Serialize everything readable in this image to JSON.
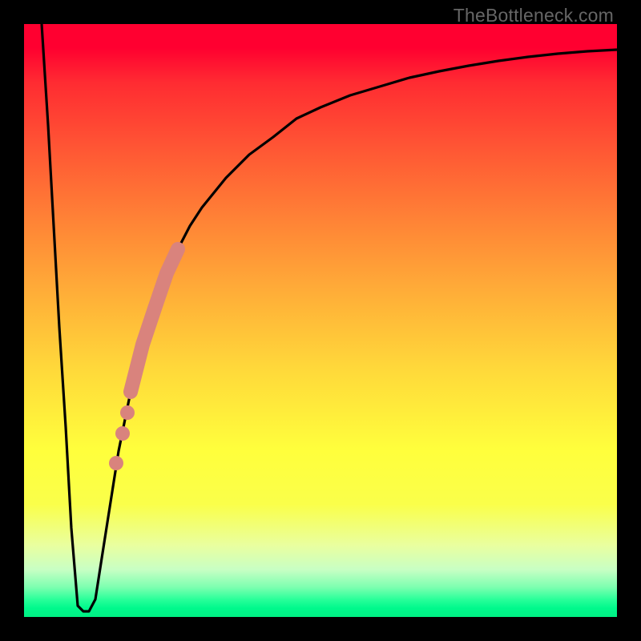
{
  "watermark": "TheBottleneck.com",
  "chart_data": {
    "type": "line",
    "title": "",
    "xlabel": "",
    "ylabel": "",
    "xlim": [
      0,
      100
    ],
    "ylim": [
      0,
      100
    ],
    "grid": false,
    "legend": false,
    "series": [
      {
        "name": "bottleneck-curve",
        "color": "#000000",
        "x": [
          3,
          4,
          5,
          6,
          7,
          8,
          9,
          10,
          11,
          12,
          13,
          14,
          16,
          18,
          20,
          22,
          24,
          26,
          28,
          30,
          34,
          38,
          42,
          46,
          50,
          55,
          60,
          65,
          70,
          75,
          80,
          85,
          90,
          95,
          100
        ],
        "y": [
          100,
          83,
          66,
          49,
          32,
          15,
          2,
          1,
          1,
          3,
          9,
          16,
          28,
          38,
          46,
          52,
          58,
          62,
          66,
          69,
          74,
          78,
          81,
          84,
          86,
          88,
          89.5,
          91,
          92,
          93,
          93.8,
          94.5,
          95,
          95.4,
          95.7
        ]
      }
    ],
    "highlight_segment": {
      "name": "highlighted-range",
      "color": "#d9837d",
      "thick_x": [
        18,
        26
      ],
      "thick_y": [
        38,
        62
      ],
      "dots": [
        {
          "x": 17.4,
          "y": 34.5
        },
        {
          "x": 16.6,
          "y": 31
        },
        {
          "x": 15.6,
          "y": 26
        }
      ]
    },
    "background_gradient": {
      "stops": [
        {
          "pos": 0.0,
          "color": "#ff0030"
        },
        {
          "pos": 0.72,
          "color": "#ffff3c"
        },
        {
          "pos": 0.97,
          "color": "#2bff9a"
        },
        {
          "pos": 1.0,
          "color": "#00f084"
        }
      ]
    }
  }
}
